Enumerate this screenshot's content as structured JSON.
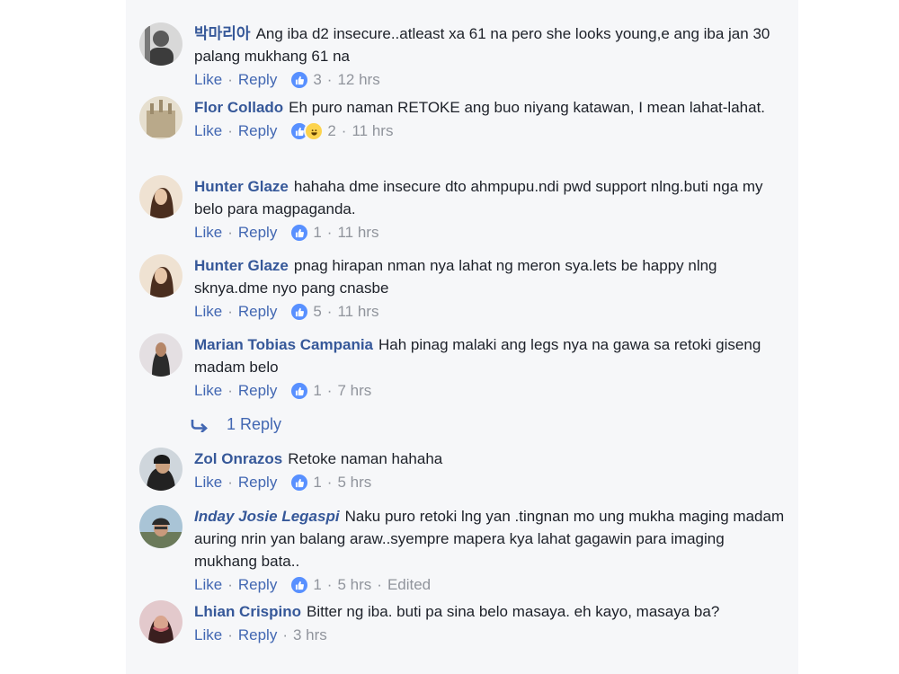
{
  "comments": [
    {
      "author": "박마리아",
      "text": "Ang iba d2 insecure..atleast xa 61 na pero she looks young,e ang iba jan 30 palang mukhang 61 na",
      "like_label": "Like",
      "reply_label": "Reply",
      "reaction_count": "3",
      "time": "12 hrs",
      "avatar_color": "#5a5a5a"
    },
    {
      "author": "Flor Collado",
      "text": "Eh puro naman RETOKE ang buo niyang katawan, I mean lahat-lahat.",
      "like_label": "Like",
      "reply_label": "Reply",
      "reaction_count": "2",
      "time": "11 hrs",
      "avatar_color": "#b9a98a"
    },
    {
      "author": "Hunter Glaze",
      "text": "hahaha dme insecure dto ahmpupu.ndi pwd support nlng.buti nga my belo para magpaganda.",
      "like_label": "Like",
      "reply_label": "Reply",
      "reaction_count": "1",
      "time": "11 hrs",
      "avatar_color": "#d7b48f"
    },
    {
      "author": "Hunter Glaze",
      "text": "pnag hirapan nman nya lahat ng meron sya.lets be happy nlng sknya.dme nyo pang cnasbe",
      "like_label": "Like",
      "reply_label": "Reply",
      "reaction_count": "5",
      "time": "11 hrs",
      "avatar_color": "#d7b48f"
    },
    {
      "author": "Marian Tobias Campania",
      "text": "Hah pinag malaki ang legs nya na gawa sa retoki giseng madam belo",
      "like_label": "Like",
      "reply_label": "Reply",
      "reaction_count": "1",
      "time": "7 hrs",
      "avatar_color": "#c9c0c3"
    },
    {
      "author": "Zol Onrazos",
      "text": "Retoke naman hahaha",
      "like_label": "Like",
      "reply_label": "Reply",
      "reaction_count": "1",
      "time": "5 hrs",
      "avatar_color": "#3a3a3a"
    },
    {
      "author": "Inday Josie Legaspi",
      "text": "Naku puro retoki lng yan .tingnan mo ung mukha maging madam auring nrin yan balang araw..syempre mapera kya lahat gagawin para imaging mukhang bata..",
      "like_label": "Like",
      "reply_label": "Reply",
      "reaction_count": "1",
      "time": "5 hrs",
      "edited": "Edited",
      "avatar_color": "#8fa8b8"
    },
    {
      "author": "Lhian Crispino",
      "text": "Bitter ng iba. buti pa sina belo masaya. eh kayo, masaya ba?",
      "like_label": "Like",
      "reply_label": "Reply",
      "time": "3 hrs",
      "avatar_color": "#c0606a"
    }
  ],
  "replies_link": {
    "label": "1 Reply",
    "icon": "reply-arrow-icon"
  },
  "colors": {
    "author": "#365899",
    "link": "#4267b2",
    "meta": "#90949c",
    "like_bubble": "#5890ff",
    "haha_bubble": "#fcd34d"
  }
}
